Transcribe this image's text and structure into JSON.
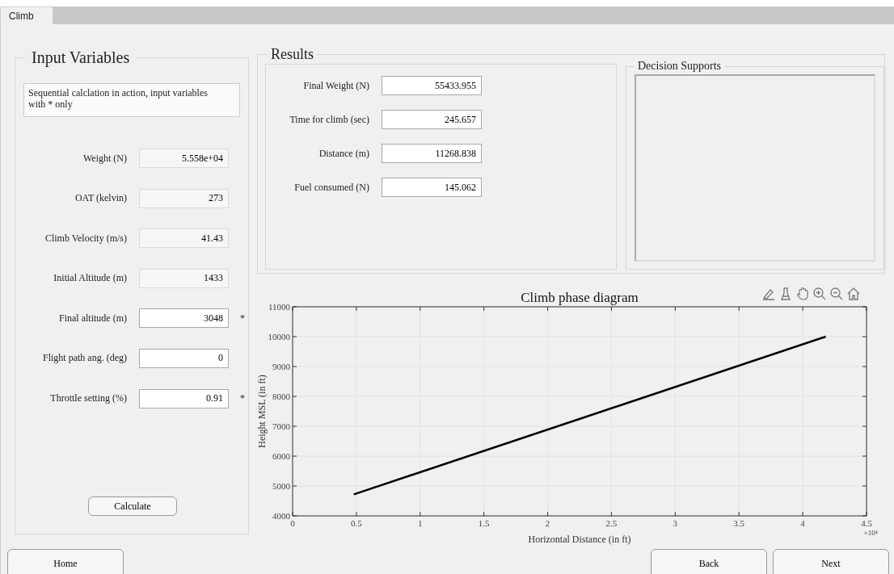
{
  "tabs": [
    {
      "label": "Climb",
      "selected": true
    }
  ],
  "input_panel": {
    "title": "Input Variables",
    "note": "Sequential calclation in action, input variables with * only",
    "fields": [
      {
        "label": "Weight (N)",
        "value": "5.558e+04",
        "editable": false
      },
      {
        "label": "OAT (kelvin)",
        "value": "273",
        "editable": false
      },
      {
        "label": "Climb Velocity (m/s)",
        "value": "41.43",
        "editable": false
      },
      {
        "label": "Initial Altitude (m)",
        "value": "1433",
        "editable": false
      },
      {
        "label": "Final altitude (m)",
        "value": "3048",
        "editable": true,
        "marker": "*"
      },
      {
        "label": "Flight path ang. (deg)",
        "value": "0",
        "editable": true
      },
      {
        "label": "Throttle setting (%)",
        "value": "0.91",
        "editable": true,
        "marker": "*"
      }
    ],
    "calculate_button": "Calculate"
  },
  "results": {
    "title": "Results",
    "fields": [
      {
        "label": "Final Weight (N)",
        "value": "55433.955"
      },
      {
        "label": "Time for climb (sec)",
        "value": "245.657"
      },
      {
        "label": "Distance (m)",
        "value": "11268.838"
      },
      {
        "label": "Fuel consumed (N)",
        "value": "145.062"
      }
    ]
  },
  "decision_supports": {
    "title": "Decision Supports"
  },
  "chart": {
    "x_multiplier": "×10⁴",
    "chart_data": {
      "type": "line",
      "title": "Climb phase diagram",
      "xlabel": "Horizontal Distance (in ft)",
      "ylabel": "Height MSL (in ft)",
      "x": [
        0.48,
        4.18
      ],
      "series": [
        {
          "color": "#000000",
          "values": [
            4720,
            10000
          ]
        }
      ],
      "grid": true,
      "xlim": [
        0,
        4.5
      ],
      "ylim": [
        4000,
        11000
      ],
      "xticks": [
        0,
        0.5,
        1,
        1.5,
        2,
        2.5,
        3,
        3.5,
        4,
        4.5
      ],
      "yticks": [
        4000,
        5000,
        6000,
        7000,
        8000,
        9000,
        10000,
        11000
      ]
    }
  },
  "nav_buttons": [
    {
      "label": "Home"
    },
    {
      "label": "Back"
    },
    {
      "label": "Next"
    }
  ]
}
